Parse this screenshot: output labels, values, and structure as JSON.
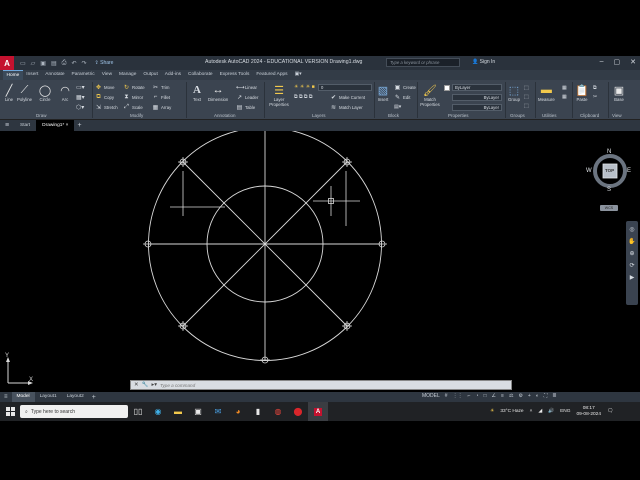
{
  "titlebar": {
    "logo": "A",
    "qat_icons": [
      "new-icon",
      "open-icon",
      "save-icon",
      "saveas-icon",
      "plot-icon",
      "undo-icon",
      "redo-icon"
    ],
    "share_label": "Share",
    "title": "Autodesk AutoCAD 2024 - EDUCATIONAL VERSION   Drawing1.dwg",
    "search_placeholder": "Type a keyword or phrase",
    "signin_label": "Sign In"
  },
  "ribbon_tabs": [
    "Home",
    "Insert",
    "Annotate",
    "Parametric",
    "View",
    "Manage",
    "Output",
    "Add-ins",
    "Collaborate",
    "Express Tools",
    "Featured Apps"
  ],
  "draw_panel": {
    "title": "Draw",
    "tools": [
      "Line",
      "Polyline",
      "Circle",
      "Arc"
    ]
  },
  "modify_panel": {
    "title": "Modify",
    "tools": [
      "Move",
      "Rotate",
      "Trim",
      "Copy",
      "Mirror",
      "Fillet",
      "Stretch",
      "Scale",
      "Array"
    ]
  },
  "annotation_panel": {
    "title": "Annotation",
    "tools": [
      "Text",
      "Dimension"
    ],
    "small_tools": [
      "Linear",
      "Leader",
      "Table"
    ]
  },
  "layers_panel": {
    "title": "Layers",
    "layer_properties": "Layer Properties",
    "current_layer": "0",
    "make_current": "Make Current",
    "match_layer": "Match Layer"
  },
  "block_panel": {
    "title": "Block",
    "insert": "Insert",
    "create": "Create",
    "edit": "Edit"
  },
  "properties_panel": {
    "title": "Properties",
    "match": "Match Properties",
    "color": "ByLayer",
    "linetype": "ByLayer",
    "lineweight": "ByLayer"
  },
  "groups_panel": {
    "title": "Groups",
    "group": "Group"
  },
  "utilities_panel": {
    "title": "Utilities",
    "measure": "Measure"
  },
  "clipboard_panel": {
    "title": "Clipboard",
    "paste": "Paste"
  },
  "view_panel": {
    "title": "View",
    "base": "Base"
  },
  "file_tabs": {
    "start": "Start",
    "active": "Drawing1*"
  },
  "viewcube": {
    "top": "TOP",
    "n": "N",
    "s": "S",
    "e": "E",
    "w": "W",
    "wcs": "WCS"
  },
  "command": {
    "placeholder": "Type a command"
  },
  "layout_tabs": [
    "Model",
    "Layout1",
    "Layout2"
  ],
  "status": {
    "model": "MODEL"
  },
  "taskbar": {
    "search_placeholder": "Type here to search",
    "weather": "33°C  Haze",
    "lang": "ENG",
    "time": "08:17",
    "date": "09-08-2024"
  },
  "colors": {
    "ribbon": "#3b4450",
    "titlebar": "#2a323c",
    "canvas": "#000000",
    "geometry": "#d9d9d9",
    "autocad_red": "#c4122f"
  }
}
